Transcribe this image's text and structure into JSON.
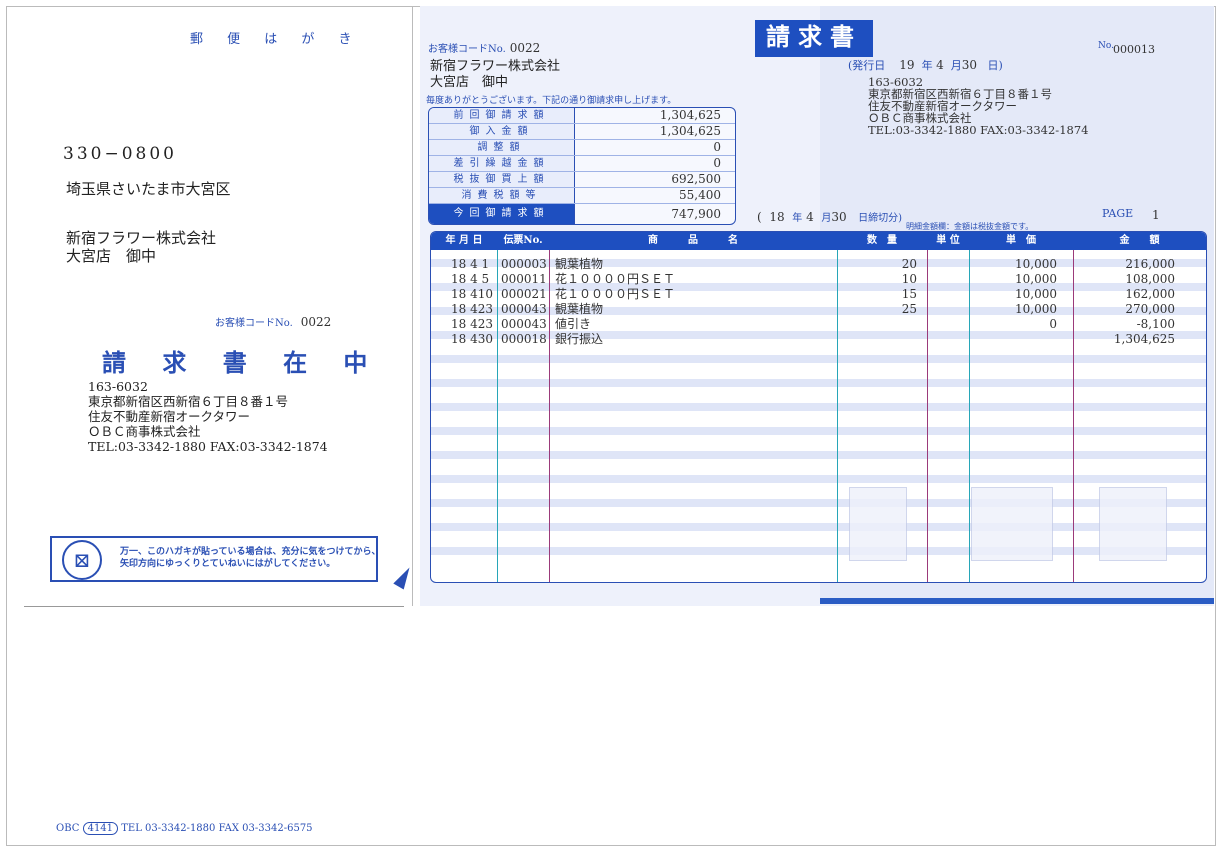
{
  "postcard": {
    "title": "郵 便 は が き",
    "zip": "330−0800",
    "address": "埼玉県さいたま市大宮区",
    "company_line1": "新宿フラワー株式会社",
    "company_line2": "大宮店　御中",
    "customer_code_label": "お客様コードNo.",
    "customer_code": "0022",
    "invoice_enclosed": "請 求 書 在 中",
    "sender": {
      "postal": "163-6032",
      "address": "東京都新宿区西新宿６丁目８番１号",
      "building": "住友不動産新宿オークタワー",
      "company": "ＯＢＣ商事株式会社",
      "tel_fax": "TEL:03-3342-1880 FAX:03-3342-1874"
    },
    "warning_line1": "万一、このハガキが貼っている場合は、充分に気をつけてから、",
    "warning_line2": "矢印方向にゆっくりとていねいにはがしてください。",
    "footer": {
      "brand": "OBC",
      "code": "4141",
      "contact": "TEL 03-3342-1880 FAX 03-3342-6575"
    }
  },
  "invoice": {
    "title": "請求書",
    "doc_no_label": "No.",
    "doc_no": "000013",
    "issue_label": "(発行日",
    "issue_year": "19",
    "issue_year_unit": "年",
    "issue_month": "4",
    "issue_month_unit": "月",
    "issue_day": "30",
    "issue_day_unit": "日)",
    "customer_code_label": "お客様コードNo.",
    "customer_code": "0022",
    "customer_name": "新宿フラワー株式会社",
    "customer_branch": "大宮店　御中",
    "thanks": "毎度ありがとうございます。下記の通り御請求申し上げます。",
    "sender": {
      "postal": "163-6032",
      "address": "東京都新宿区西新宿６丁目８番１号",
      "building": "住友不動産新宿オークタワー",
      "company": "ＯＢＣ商事株式会社",
      "tel_fax": "TEL:03-3342-1880 FAX:03-3342-1874"
    },
    "summary": [
      {
        "label": "前回御請求額",
        "value": "1,304,625"
      },
      {
        "label": "御入金額",
        "value": "1,304,625"
      },
      {
        "label": "調整額",
        "value": "0"
      },
      {
        "label": "差引繰越金額",
        "value": "0"
      },
      {
        "label": "税抜御買上額",
        "value": "692,500"
      },
      {
        "label": "消費税額等",
        "value": "55,400"
      },
      {
        "label": "今回御請求額",
        "value": "747,900"
      }
    ],
    "period_open": "(",
    "period_year": "18",
    "period_year_unit": "年",
    "period_month": "4",
    "period_month_unit": "月",
    "period_day": "30",
    "period_suffix": "日締切分)",
    "period_note": "明細金額欄：金額は税抜金額です。",
    "page_label": "PAGE",
    "page_no": "1",
    "table_headers": [
      "年 月 日",
      "伝票No.",
      "商　　　品　　　名",
      "数　量",
      "単 位",
      "単　価",
      "金　　額"
    ],
    "rows": [
      {
        "date": "18 4 1",
        "slip": "000003",
        "item": "観葉植物",
        "qty": "20",
        "unit": "",
        "price": "10,000",
        "amount": "216,000"
      },
      {
        "date": "18 4 5",
        "slip": "000011",
        "item": "花１００００円ＳＥＴ",
        "qty": "10",
        "unit": "",
        "price": "10,000",
        "amount": "108,000"
      },
      {
        "date": "18 410",
        "slip": "000021",
        "item": "花１００００円ＳＥＴ",
        "qty": "15",
        "unit": "",
        "price": "10,000",
        "amount": "162,000"
      },
      {
        "date": "18 423",
        "slip": "000043",
        "item": "観葉植物",
        "qty": "25",
        "unit": "",
        "price": "10,000",
        "amount": "270,000"
      },
      {
        "date": "18 423",
        "slip": "000043",
        "item": "値引き",
        "qty": "",
        "unit": "",
        "price": "0",
        "amount": "-8,100"
      },
      {
        "date": "18 430",
        "slip": "000018",
        "item": "銀行振込",
        "qty": "",
        "unit": "",
        "price": "",
        "amount": "1,304,625"
      }
    ]
  },
  "colors": {
    "brand_blue": "#1e4fc0",
    "text_blue": "#2a4fb4",
    "stripe": "#dfe5f7"
  }
}
